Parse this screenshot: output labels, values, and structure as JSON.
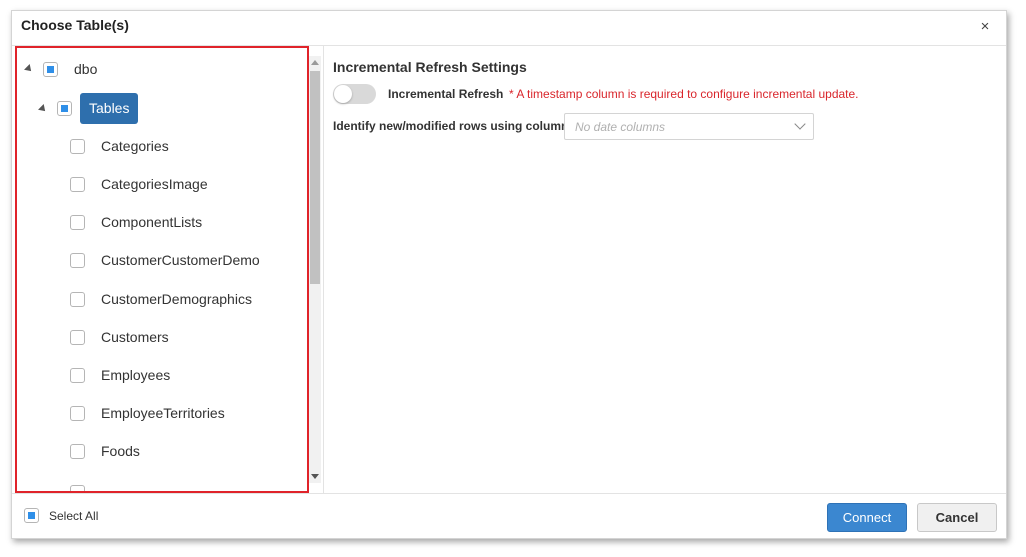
{
  "dialog": {
    "title": "Choose Table(s)",
    "close_glyph": "×"
  },
  "tree": {
    "root": {
      "label": "dbo",
      "state": "partial",
      "expanded": true
    },
    "folder": {
      "label": "Tables",
      "state": "partial",
      "expanded": true,
      "selected": true
    },
    "items": [
      {
        "label": "Categories",
        "checked": false
      },
      {
        "label": "CategoriesImage",
        "checked": false
      },
      {
        "label": "ComponentLists",
        "checked": false
      },
      {
        "label": "CustomerCustomerDemo",
        "checked": false
      },
      {
        "label": "CustomerDemographics",
        "checked": false
      },
      {
        "label": "Customers",
        "checked": false
      },
      {
        "label": "Employees",
        "checked": false
      },
      {
        "label": "EmployeeTerritories",
        "checked": false
      },
      {
        "label": "Foods",
        "checked": false
      }
    ]
  },
  "settings": {
    "heading": "Incremental Refresh Settings",
    "toggle_label": "Incremental Refresh",
    "toggle_on": false,
    "warning": "* A timestamp column is required to configure incremental update.",
    "column_label": "Identify new/modified rows using column",
    "column_placeholder": "No date columns"
  },
  "footer": {
    "select_all_label": "Select All",
    "select_all_state": "partial",
    "connect_label": "Connect",
    "cancel_label": "Cancel"
  },
  "colors": {
    "accent": "#3b87d0",
    "selected_node": "#2e6fad",
    "warning": "#d9262c",
    "highlight_border": "#e0232a"
  }
}
